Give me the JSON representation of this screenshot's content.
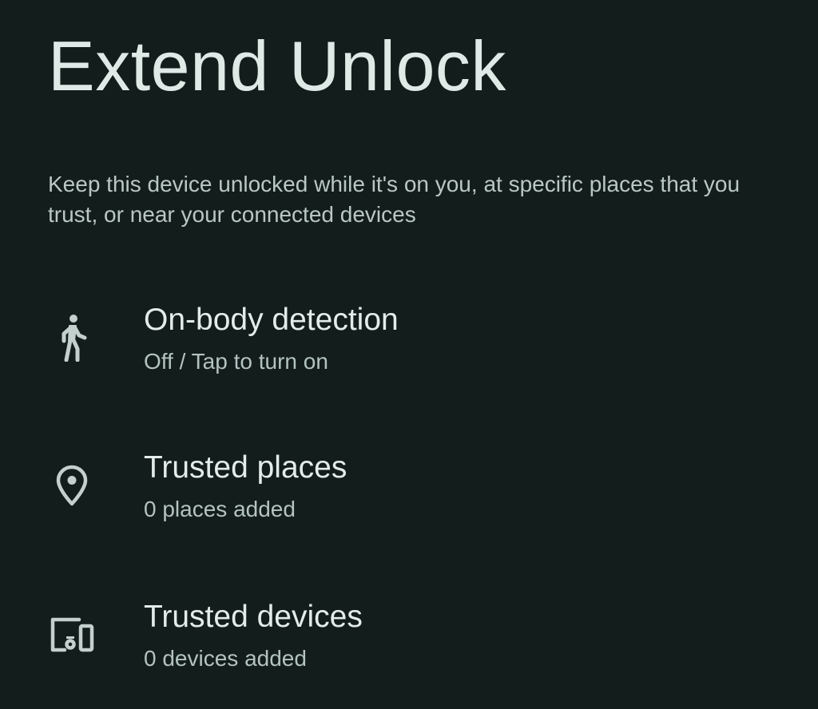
{
  "page": {
    "title": "Extend Unlock",
    "description": "Keep this device unlocked while it's on you, at specific places that you trust, or near your connected devices"
  },
  "settings": [
    {
      "icon": "walking-person-icon",
      "title": "On-body detection",
      "summary": "Off / Tap to turn on"
    },
    {
      "icon": "location-pin-icon",
      "title": "Trusted places",
      "summary": "0 places added"
    },
    {
      "icon": "devices-icon",
      "title": "Trusted devices",
      "summary": "0 devices added"
    }
  ],
  "colors": {
    "background": "#121d1c",
    "title_text": "#dfeae7",
    "body_text": "#bac8c5",
    "icon": "#c4d0cd"
  }
}
